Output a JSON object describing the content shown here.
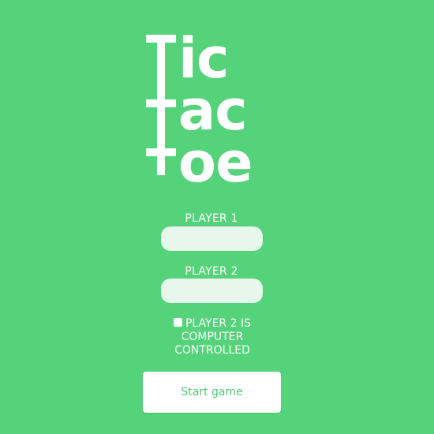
{
  "title": {
    "line1_initial": "T",
    "line1_rest": "ic",
    "line2_initial": "T",
    "line2_rest": "ac",
    "line3_initial": "T",
    "line3_rest": "oe"
  },
  "form": {
    "player1_label": "PLAYER 1",
    "player1_value": "",
    "player1_placeholder": "",
    "player2_label": "PLAYER 2",
    "player2_value": "",
    "player2_placeholder": "",
    "computer_checkbox_label": "PLAYER 2 IS COMPUTER CONTROLLED",
    "computer_checked": false,
    "start_button": "Start game"
  },
  "colors": {
    "background": "#54d37a",
    "input_background": "#e7f7ec",
    "button_background": "#ffffff",
    "button_text": "#53c778",
    "text": "#ffffff"
  }
}
